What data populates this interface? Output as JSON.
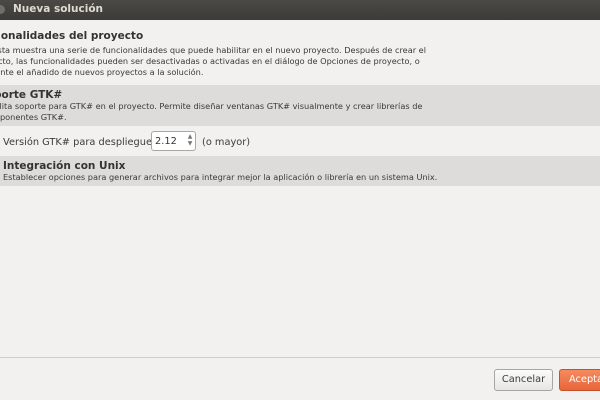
{
  "window": {
    "title": "Nueva solución"
  },
  "header": {
    "title": "cionalidades del proyecto",
    "lines": [
      "lista muestra una serie de funcionalidades que puede habilitar en el nuevo proyecto. Después de crear el",
      "ecto, las funcionalidades pueden ser desactivadas o activadas en el diálogo de Opciones de proyecto, o",
      "iante el añadido de nuevos proyectos a la solución."
    ]
  },
  "gtk": {
    "title": "porte GTK#",
    "lines": [
      "bilita soporte para GTK# en el proyecto. Permite diseñar ventanas GTK# visualmente y crear librerías de",
      "mponentes GTK#."
    ],
    "version_label": "Versión GTK# para despliegue:",
    "version_value": "2.12",
    "version_suffix": "(o mayor)"
  },
  "unix": {
    "title": "Integración con Unix",
    "description": "Establecer opciones para generar archivos para integrar mejor la aplicación o librería en un sistema Unix."
  },
  "buttons": {
    "cancel": "Cancelar",
    "ok": "Aceptar"
  },
  "icons": {
    "spin_up": "spin-up-arrow-icon",
    "spin_down": "spin-down-arrow-icon"
  },
  "colors": {
    "titlebar": "#3c3b37",
    "accent": "#e8653a",
    "section_bg": "#dedcda",
    "window_bg": "#f2f1f0"
  }
}
